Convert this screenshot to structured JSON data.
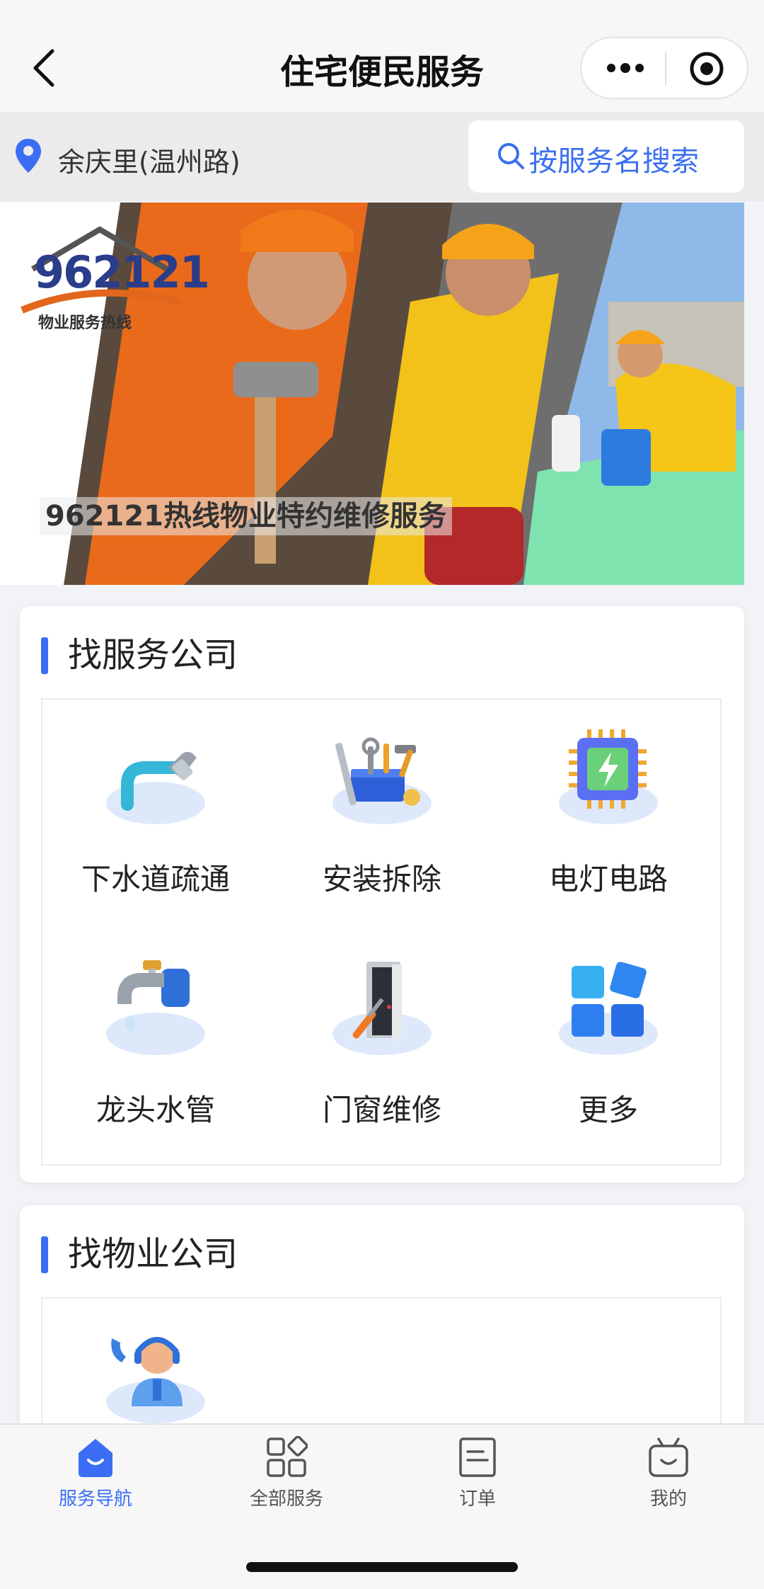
{
  "nav": {
    "title": "住宅便民服务",
    "back_icon": "chevron-left-icon",
    "more_icon": "more-dots-icon",
    "target_icon": "target-icon"
  },
  "location": {
    "text": "余庆里(温州路)",
    "icon": "location-pin-icon"
  },
  "search": {
    "label": "按服务名搜索",
    "icon": "search-icon"
  },
  "banner": {
    "logo_number": "962121",
    "logo_subtitle": "物业服务热线",
    "caption": "962121热线物业特约维修服务"
  },
  "sections": [
    {
      "title": "找服务公司",
      "items": [
        {
          "label": "下水道疏通",
          "icon": "pipe-icon"
        },
        {
          "label": "安装拆除",
          "icon": "toolbox-icon"
        },
        {
          "label": "电灯电路",
          "icon": "chip-icon"
        },
        {
          "label": "龙头水管",
          "icon": "faucet-icon"
        },
        {
          "label": "门窗维修",
          "icon": "door-icon"
        },
        {
          "label": "更多",
          "icon": "grid-more-icon"
        }
      ]
    },
    {
      "title": "找物业公司",
      "items": [
        {
          "label": "",
          "icon": "customer-service-icon"
        }
      ]
    }
  ],
  "tabs": [
    {
      "label": "服务导航",
      "icon": "home-smile-icon",
      "active": true
    },
    {
      "label": "全部服务",
      "icon": "apps-icon",
      "active": false
    },
    {
      "label": "订单",
      "icon": "order-icon",
      "active": false
    },
    {
      "label": "我的",
      "icon": "profile-tv-icon",
      "active": false
    }
  ],
  "colors": {
    "accent": "#3b6ef5",
    "search_text": "#3a6ff0",
    "plate": "#dde9fb"
  }
}
